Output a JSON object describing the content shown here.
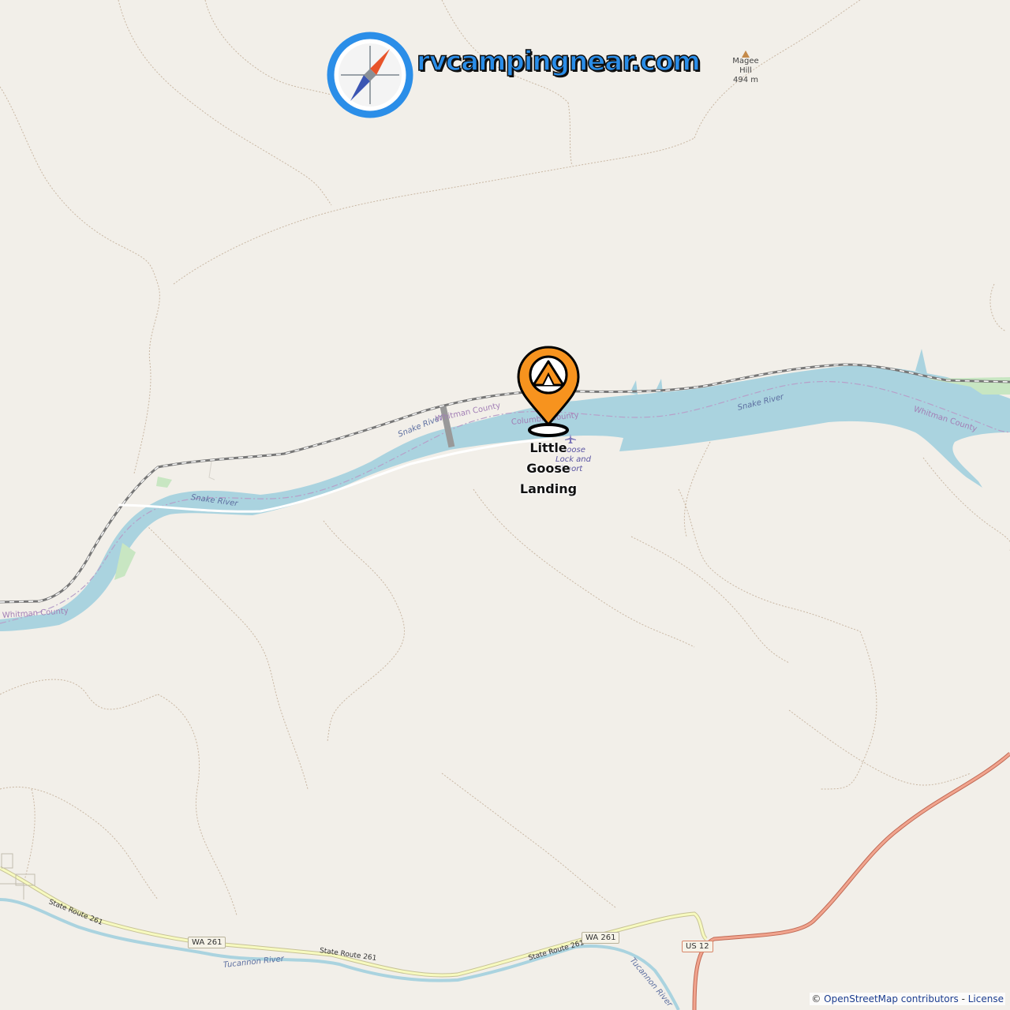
{
  "brand": {
    "name": "rvcampingnear.com",
    "logo_icon": "compass-icon",
    "colors": {
      "ring": "#2b8ee8",
      "needle_north": "#e8542a",
      "needle_south": "#3b55b3"
    }
  },
  "map": {
    "background": "#f2efe9",
    "water_color": "#aad3df",
    "marker": {
      "icon": "campsite-pin-icon",
      "color": "#f7931e",
      "place_name_lines": [
        "Little",
        "Goose",
        "Landing"
      ]
    },
    "peak": {
      "icon": "peak-triangle-icon",
      "name_lines": [
        "Magee",
        "Hill"
      ],
      "elevation": "494 m"
    },
    "poi": {
      "icon": "airport-icon",
      "lines": [
        ": Goose",
        "Lock and",
        "Airport"
      ]
    },
    "river_labels": [
      "Snake River",
      "Snake River",
      "Snake River",
      "Tucannon River",
      "Tucannon River"
    ],
    "county_labels": [
      "Whitman County",
      "Columbia County",
      "Whitman County",
      "Whitman County"
    ],
    "road_labels": [
      "State Route 261",
      "State Route 261",
      "State Route 261"
    ],
    "shields": [
      "WA 261",
      "WA 261",
      "US 12"
    ],
    "attribution": {
      "prefix": "© ",
      "link": "OpenStreetMap contributors",
      "separator": " - ",
      "license": "License"
    }
  }
}
